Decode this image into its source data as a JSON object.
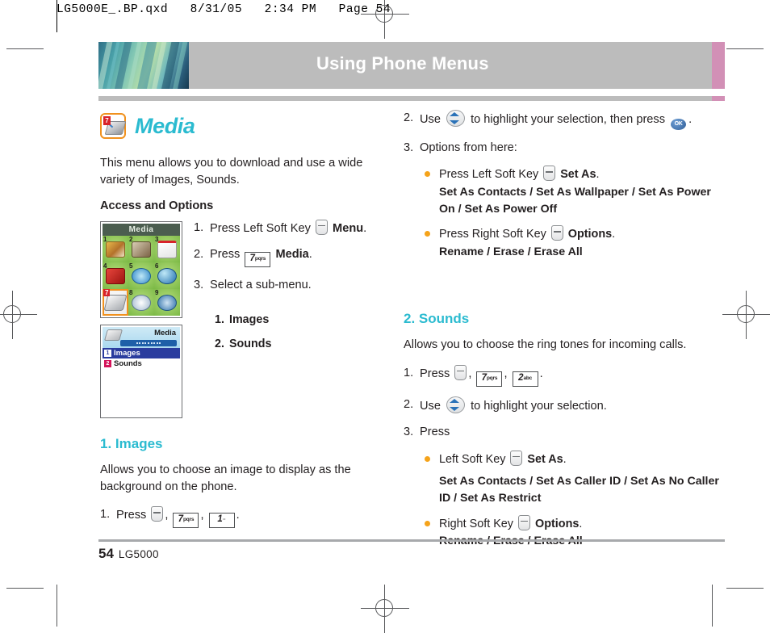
{
  "prepress": {
    "slug": "LG5000E_.BP.qxd   8/31/05   2:34 PM   Page 54"
  },
  "banner": {
    "title": "Using Phone Menus"
  },
  "media": {
    "icon_name": "media-disc-icon",
    "icon_badge": "7",
    "title": "Media",
    "intro": "This menu allows you to download and use a wide variety of Images, Sounds.",
    "section_label": "Access and Options"
  },
  "access_steps": [
    {
      "n": "1.",
      "pre": "Press Left Soft Key",
      "key": "softkey",
      "post": "Menu",
      "tail": "."
    },
    {
      "n": "2.",
      "pre": "Press",
      "key": "7pqrs",
      "post": "Media",
      "tail": "."
    },
    {
      "n": "3.",
      "pre": "Select a sub-menu.",
      "key": "",
      "post": "",
      "tail": ""
    }
  ],
  "sub_menus": [
    {
      "n": "1.",
      "label": "Images"
    },
    {
      "n": "2.",
      "label": "Sounds"
    }
  ],
  "screen_grid": {
    "title": "Media",
    "cells": [
      {
        "n": "1",
        "name": "photos-icon",
        "selected": false
      },
      {
        "n": "2",
        "name": "book-icon",
        "selected": false
      },
      {
        "n": "3",
        "name": "notepad-phone-icon",
        "selected": false
      },
      {
        "n": "4",
        "name": "mailbox-icon",
        "selected": false
      },
      {
        "n": "5",
        "name": "swirl-icon",
        "selected": false
      },
      {
        "n": "6",
        "name": "globe-icon",
        "selected": false
      },
      {
        "n": "7",
        "name": "media-disc-icon",
        "selected": true
      },
      {
        "n": "8",
        "name": "clock-icon",
        "selected": false
      },
      {
        "n": "9",
        "name": "settings-gear-icon",
        "selected": false
      }
    ]
  },
  "screen_list": {
    "title": "Media",
    "rows": [
      {
        "ix": "1",
        "label": "Images",
        "selected": true
      },
      {
        "ix": "2",
        "label": "Sounds",
        "selected": false
      }
    ]
  },
  "images_section": {
    "heading_num": "1",
    "heading_dot": ". ",
    "heading": "Images",
    "desc": "Allows you to choose an image to display as the background on the phone.",
    "step1_n": "1.",
    "step1_pre": "Press",
    "step1_keys": [
      "softkey",
      "7pqrs",
      "1sym"
    ],
    "step1_tail": "."
  },
  "images_right": {
    "step2_n": "2.",
    "step2_pre": "Use",
    "step2_mid": "to highlight your selection, then press",
    "step2_tail": ".",
    "step3_n": "3.",
    "step3_text": "Options from here:",
    "bullets": [
      {
        "pre": "Press Left Soft Key",
        "key": "softkey",
        "bold": "Set As",
        "tail": ".",
        "detail": "Set As Contacts / Set As Wallpaper / Set As Power On / Set As Power Off"
      },
      {
        "pre": "Press Right Soft Key",
        "key": "softkey",
        "bold": "Options",
        "tail": ".",
        "detail": "Rename / Erase / Erase All"
      }
    ]
  },
  "sounds_section": {
    "heading_num": "2",
    "heading_dot": ". ",
    "heading": "Sounds",
    "desc": "Allows you to choose the ring tones for incoming calls.",
    "step1_n": "1.",
    "step1_pre": "Press",
    "step1_keys": [
      "softkey",
      "7pqrs",
      "2abc"
    ],
    "step1_tail": ".",
    "step2_n": "2.",
    "step2_pre": "Use",
    "step2_mid": "to highlight your selection.",
    "step3_n": "3.",
    "step3_text": "Press",
    "bullets": [
      {
        "pre": "Left Soft Key",
        "key": "softkey",
        "bold": "Set As",
        "tail": ".",
        "detail": "Set As Contacts / Set As Caller ID / Set As No Caller ID / Set As Restrict"
      },
      {
        "pre": "Right Soft Key",
        "key": "softkey",
        "bold": "Options",
        "tail": ".",
        "detail": "Rename / Erase / Erase All"
      }
    ]
  },
  "keys": {
    "k7": "7",
    "k7sup": "pqrs",
    "k1": "1",
    "k1sup": "··",
    "k2": "2",
    "k2sup": "abc",
    "ok": "OK"
  },
  "footer": {
    "page": "54",
    "book": "LG5000"
  },
  "colors": {
    "teal": "#2bbbd0",
    "orange": "#f5a31a",
    "banner_gray": "#bcbcbc",
    "banner_pink": "#d290b6"
  }
}
